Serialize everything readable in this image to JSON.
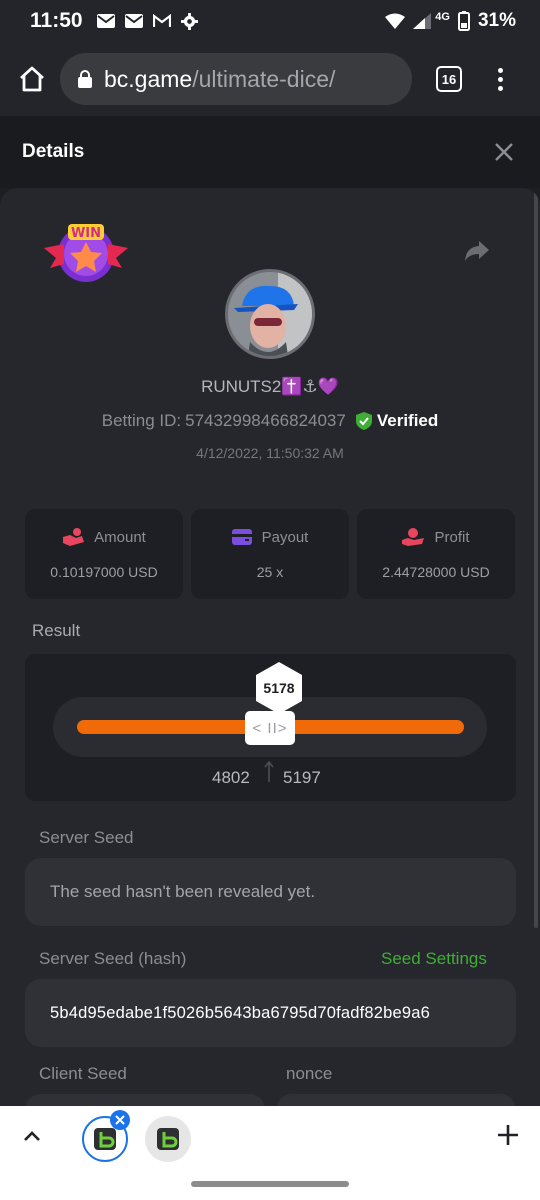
{
  "status_bar": {
    "time": "11:50",
    "network": "4G",
    "battery": "31%"
  },
  "browser": {
    "url_host": "bc.game",
    "url_path": "/ultimate-dice/",
    "tab_count": "16"
  },
  "header": {
    "title": "Details"
  },
  "player": {
    "username": "RUNUTS2✝️⚓💜",
    "betting_id_label": "Betting ID:",
    "betting_id": "57432998466824037",
    "verified_label": "Verified",
    "timestamp": "4/12/2022, 11:50:32 AM"
  },
  "stats": [
    {
      "label": "Amount",
      "value": "0.10197000 USD",
      "icon": "coin-hand-icon",
      "icon_color": "#e8455f"
    },
    {
      "label": "Payout",
      "value": "25 x",
      "icon": "wallet-icon",
      "icon_color": "#7a4fe0"
    },
    {
      "label": "Profit",
      "value": "2.44728000 USD",
      "icon": "profit-hand-icon",
      "icon_color": "#e8455f"
    }
  ],
  "result": {
    "label": "Result",
    "value": "5178",
    "handle_glyph": "< II>",
    "range_low": "4802",
    "range_high": "5197",
    "accent": "#f06a07"
  },
  "server_seed": {
    "label": "Server Seed",
    "value": "The seed hasn't been revealed yet."
  },
  "server_seed_hash": {
    "label": "Server Seed (hash)",
    "settings_link": "Seed Settings",
    "value": "5b4d95edabe1f5026b5643ba6795d70fadf82be9a6"
  },
  "client_seed": {
    "label": "Client Seed"
  },
  "nonce": {
    "label": "nonce"
  },
  "colors": {
    "green": "#3fae36",
    "background": "#1d1e22",
    "card": "#26272d"
  }
}
